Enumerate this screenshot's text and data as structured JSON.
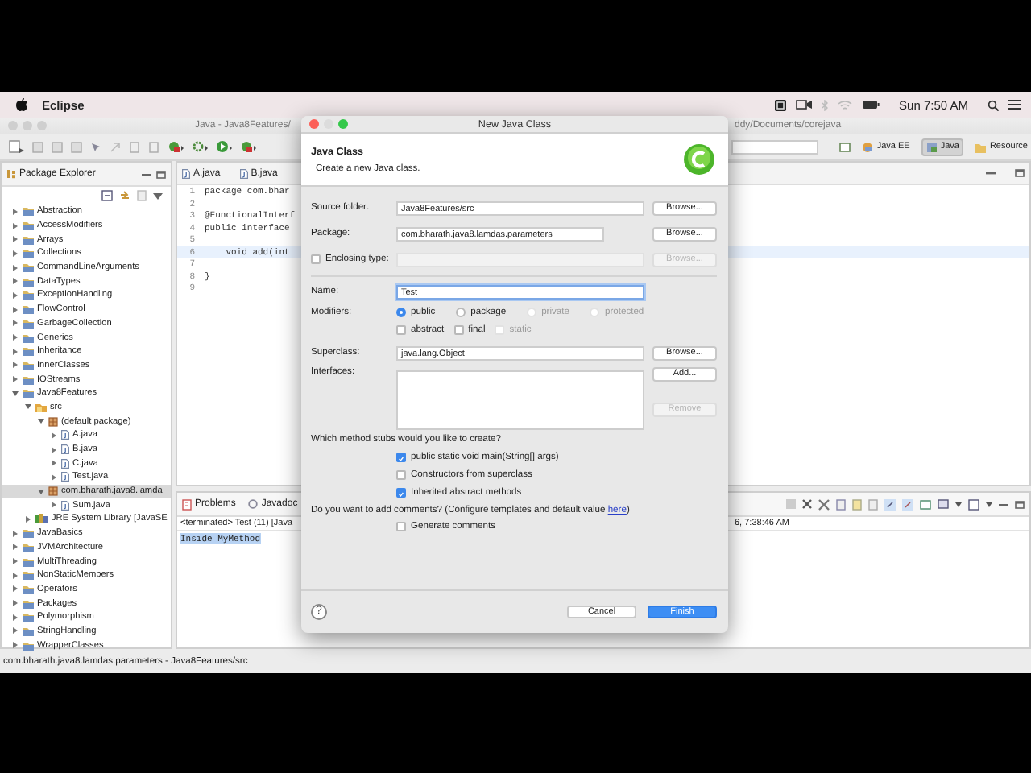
{
  "menubar": {
    "app": "Eclipse",
    "clock": "Sun 7:50 AM"
  },
  "window": {
    "title_parts": [
      "Java - Java8Features/",
      "ddy/Documents/corejava"
    ]
  },
  "perspectives": [
    {
      "label": "Java EE",
      "selected": false
    },
    {
      "label": "Java",
      "selected": true
    },
    {
      "label": "Resource",
      "selected": false
    }
  ],
  "package_explorer": {
    "title": "Package Explorer",
    "tree": [
      {
        "label": "Abstraction",
        "kind": "project",
        "expanded": false,
        "selected": false
      },
      {
        "label": "AccessModifiers",
        "kind": "project",
        "expanded": false,
        "selected": false
      },
      {
        "label": "Arrays",
        "kind": "project",
        "expanded": false,
        "selected": false
      },
      {
        "label": "Collections",
        "kind": "project",
        "expanded": false,
        "selected": false
      },
      {
        "label": "CommandLineArguments",
        "kind": "project",
        "expanded": false,
        "selected": false
      },
      {
        "label": "DataTypes",
        "kind": "project",
        "expanded": false,
        "selected": false
      },
      {
        "label": "ExceptionHandling",
        "kind": "project",
        "expanded": false,
        "selected": false
      },
      {
        "label": "FlowControl",
        "kind": "project",
        "expanded": false,
        "selected": false
      },
      {
        "label": "GarbageCollection",
        "kind": "project",
        "expanded": false,
        "selected": false
      },
      {
        "label": "Generics",
        "kind": "project",
        "expanded": false,
        "selected": false
      },
      {
        "label": "Inheritance",
        "kind": "project",
        "expanded": false,
        "selected": false
      },
      {
        "label": "InnerClasses",
        "kind": "project",
        "expanded": false,
        "selected": false
      },
      {
        "label": "IOStreams",
        "kind": "project",
        "expanded": false,
        "selected": false
      },
      {
        "label": "Java8Features",
        "kind": "project",
        "expanded": true,
        "selected": false,
        "children": [
          {
            "label": "src",
            "kind": "source",
            "expanded": true,
            "selected": false,
            "children": [
              {
                "label": "(default package)",
                "kind": "package",
                "expanded": true,
                "selected": false,
                "children": [
                  {
                    "label": "A.java",
                    "kind": "file",
                    "expanded": false,
                    "selected": false
                  },
                  {
                    "label": "B.java",
                    "kind": "file",
                    "expanded": false,
                    "selected": false
                  },
                  {
                    "label": "C.java",
                    "kind": "file",
                    "expanded": false,
                    "selected": false
                  },
                  {
                    "label": "Test.java",
                    "kind": "file",
                    "expanded": false,
                    "selected": false
                  }
                ]
              },
              {
                "label": "com.bharath.java8.lamda",
                "kind": "package",
                "expanded": true,
                "selected": true,
                "children": [
                  {
                    "label": "Sum.java",
                    "kind": "file",
                    "expanded": false,
                    "selected": false
                  }
                ]
              }
            ]
          },
          {
            "label": "JRE System Library [JavaSE",
            "kind": "library",
            "expanded": false,
            "selected": false
          }
        ]
      },
      {
        "label": "JavaBasics",
        "kind": "project",
        "expanded": false,
        "selected": false
      },
      {
        "label": "JVMArchitecture",
        "kind": "project",
        "expanded": false,
        "selected": false
      },
      {
        "label": "MultiThreading",
        "kind": "project",
        "expanded": false,
        "selected": false
      },
      {
        "label": "NonStaticMembers",
        "kind": "project",
        "expanded": false,
        "selected": false
      },
      {
        "label": "Operators",
        "kind": "project",
        "expanded": false,
        "selected": false
      },
      {
        "label": "Packages",
        "kind": "project",
        "expanded": false,
        "selected": false
      },
      {
        "label": "Polymorphism",
        "kind": "project",
        "expanded": false,
        "selected": false
      },
      {
        "label": "StringHandling",
        "kind": "project",
        "expanded": false,
        "selected": false
      },
      {
        "label": "WrapperClasses",
        "kind": "project",
        "expanded": false,
        "selected": false
      }
    ]
  },
  "editor": {
    "tabs": [
      "A.java",
      "B.java"
    ],
    "lines": [
      {
        "number": "1",
        "code": "package com.bhar",
        "current": false
      },
      {
        "number": "2",
        "current": false
      },
      {
        "number": "3",
        "code": "@FunctionalInterf",
        "current": false
      },
      {
        "number": "4",
        "code": "public interface",
        "current": false
      },
      {
        "number": "5",
        "current": false
      },
      {
        "number": "6",
        "code": "    void add(int",
        "current": true
      },
      {
        "number": "7",
        "current": false
      },
      {
        "number": "8",
        "code": "}",
        "current": false
      },
      {
        "number": "9",
        "current": false
      }
    ]
  },
  "console": {
    "tabs": [
      "Problems",
      "Javadoc"
    ],
    "header_parts": [
      "<terminated> Test (11) [Java",
      "6, 7:38:46 AM"
    ],
    "output": [
      {
        "text": "Inside MyMethod",
        "selected": true
      }
    ]
  },
  "status_bar": "com.bharath.java8.lamdas.parameters - Java8Features/src",
  "dialog": {
    "title": "New Java Class",
    "heading": "Java Class",
    "description": "Create a new Java class.",
    "fields": [
      {
        "kind": "text",
        "label": "Source folder:",
        "value": "Java8Features/src",
        "button": {
          "label": "Browse...",
          "disabled": false
        }
      },
      {
        "kind": "short",
        "label": "Package:",
        "value": "com.bharath.java8.lamdas.parameters",
        "button": {
          "label": "Browse...",
          "disabled": false
        }
      },
      {
        "kind": "checkbox",
        "label": "Enclosing type:",
        "checked": false,
        "button": {
          "label": "Browse...",
          "disabled": true
        }
      }
    ],
    "name": {
      "label": "Name:",
      "value": "Test",
      "focused": true
    },
    "modifiers": {
      "label": "Modifiers:",
      "radios": [
        {
          "label": "public",
          "selected": true,
          "disabled": false
        },
        {
          "label": "package",
          "selected": false,
          "disabled": false
        },
        {
          "label": "private",
          "selected": false,
          "disabled": true
        },
        {
          "label": "protected",
          "selected": false,
          "disabled": true
        }
      ],
      "checkboxes": [
        {
          "label": "abstract",
          "checked": false,
          "disabled": false
        },
        {
          "label": "final",
          "checked": false,
          "disabled": false
        },
        {
          "label": "static",
          "checked": false,
          "disabled": true
        }
      ]
    },
    "superclass": {
      "label": "Superclass:",
      "value": "java.lang.Object",
      "button": {
        "label": "Browse...",
        "disabled": false
      }
    },
    "interfaces": {
      "label": "Interfaces:",
      "buttons": [
        {
          "label": "Add...",
          "disabled": false
        },
        {
          "label": "Remove",
          "disabled": true
        }
      ]
    },
    "stubs": {
      "question": "Which method stubs would you like to create?",
      "options": [
        {
          "label": "public static void main(String[] args)",
          "checked": true
        },
        {
          "label": "Constructors from superclass",
          "checked": false
        },
        {
          "label": "Inherited abstract methods",
          "checked": true
        }
      ]
    },
    "comments": {
      "before": "Do you want to add comments? (Configure templates and default value ",
      "link": "here",
      "after": ")",
      "option": {
        "label": "Generate comments",
        "checked": false
      }
    },
    "help": "?",
    "buttons": [
      {
        "label": "Cancel",
        "kind": "normal"
      },
      {
        "label": "Finish",
        "kind": "default"
      }
    ]
  }
}
